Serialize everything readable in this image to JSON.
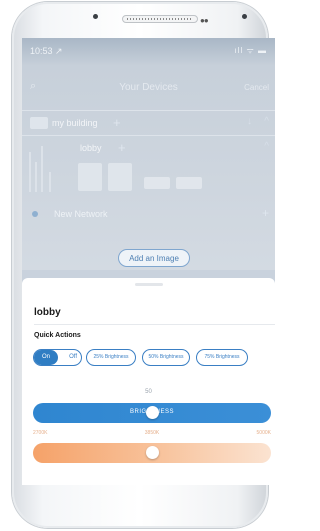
{
  "status_bar": {
    "time": "10:53 ↗",
    "indicators": "ıll ᯤ ▬"
  },
  "header": {
    "search_icon": "search-icon",
    "title": "Your Devices",
    "cancel": "Cancel"
  },
  "tree": {
    "building": {
      "label": "my building",
      "plus": "+",
      "down": "↓",
      "caret": "^"
    },
    "room": {
      "label": "lobby",
      "plus": "+",
      "caret": "^"
    },
    "network": {
      "label": "New Network",
      "plus": "+"
    }
  },
  "add_image_button": "Add an Image",
  "sheet": {
    "title": "lobby",
    "quick_actions_title": "Quick Actions",
    "toggle": {
      "on": "On",
      "off": "Off",
      "state": "on"
    },
    "presets": [
      "25% Brightness",
      "50% Brightness",
      "75% Brightness"
    ],
    "brightness": {
      "value": "50",
      "label": "BRIGHTNESS",
      "level": 0.5
    },
    "temperature": {
      "min": "2700K",
      "mid": "3850K",
      "max": "5000K",
      "level": 0.5
    }
  },
  "colors": {
    "accent": "#2f7dc3",
    "temperature_warm": "#f5a269"
  }
}
